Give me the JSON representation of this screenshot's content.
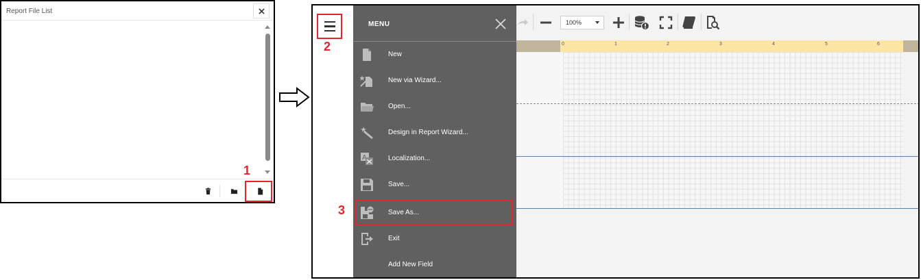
{
  "left_panel": {
    "title": "Report File List",
    "buttons": {
      "close_icon": "close-icon",
      "delete_icon": "trash-icon",
      "open_icon": "folder-icon",
      "new_icon": "new-file-icon"
    }
  },
  "steps": {
    "one": "1",
    "two": "2",
    "three": "3"
  },
  "designer": {
    "menu": {
      "title": "MENU",
      "items": [
        {
          "label": "New",
          "icon": "new-file-icon"
        },
        {
          "label": "New via Wizard...",
          "icon": "wizard-icon"
        },
        {
          "label": "Open...",
          "icon": "folder-icon"
        },
        {
          "label": "Design in Report Wizard...",
          "icon": "magic-wand-icon"
        },
        {
          "label": "Localization...",
          "icon": "localization-icon"
        },
        {
          "label": "Save...",
          "icon": "save-icon"
        },
        {
          "label": "Save As...",
          "icon": "save-as-icon"
        },
        {
          "label": "Exit",
          "icon": "exit-icon"
        },
        {
          "label": "Add New Field",
          "icon": ""
        }
      ]
    },
    "toolbar": {
      "zoom_value": "100%"
    },
    "ruler": {
      "marks": [
        "0",
        "1",
        "2",
        "3",
        "4",
        "5",
        "6"
      ]
    }
  },
  "colors": {
    "highlight": "#e8232a",
    "menu_bg": "#606060",
    "ruler": "#fde6a4"
  }
}
